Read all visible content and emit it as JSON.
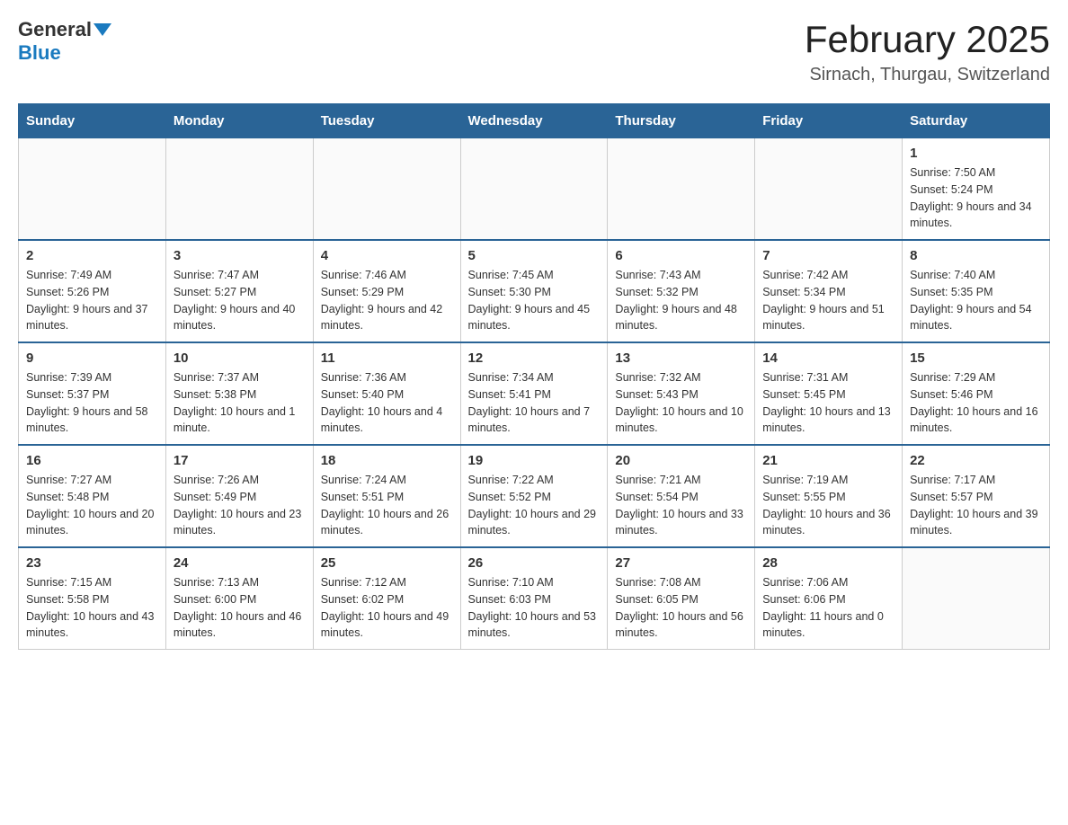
{
  "header": {
    "logo": {
      "general": "General",
      "blue": "Blue"
    },
    "title": "February 2025",
    "location": "Sirnach, Thurgau, Switzerland"
  },
  "weekdays": [
    "Sunday",
    "Monday",
    "Tuesday",
    "Wednesday",
    "Thursday",
    "Friday",
    "Saturday"
  ],
  "weeks": [
    [
      {
        "day": "",
        "info": ""
      },
      {
        "day": "",
        "info": ""
      },
      {
        "day": "",
        "info": ""
      },
      {
        "day": "",
        "info": ""
      },
      {
        "day": "",
        "info": ""
      },
      {
        "day": "",
        "info": ""
      },
      {
        "day": "1",
        "info": "Sunrise: 7:50 AM\nSunset: 5:24 PM\nDaylight: 9 hours and 34 minutes."
      }
    ],
    [
      {
        "day": "2",
        "info": "Sunrise: 7:49 AM\nSunset: 5:26 PM\nDaylight: 9 hours and 37 minutes."
      },
      {
        "day": "3",
        "info": "Sunrise: 7:47 AM\nSunset: 5:27 PM\nDaylight: 9 hours and 40 minutes."
      },
      {
        "day": "4",
        "info": "Sunrise: 7:46 AM\nSunset: 5:29 PM\nDaylight: 9 hours and 42 minutes."
      },
      {
        "day": "5",
        "info": "Sunrise: 7:45 AM\nSunset: 5:30 PM\nDaylight: 9 hours and 45 minutes."
      },
      {
        "day": "6",
        "info": "Sunrise: 7:43 AM\nSunset: 5:32 PM\nDaylight: 9 hours and 48 minutes."
      },
      {
        "day": "7",
        "info": "Sunrise: 7:42 AM\nSunset: 5:34 PM\nDaylight: 9 hours and 51 minutes."
      },
      {
        "day": "8",
        "info": "Sunrise: 7:40 AM\nSunset: 5:35 PM\nDaylight: 9 hours and 54 minutes."
      }
    ],
    [
      {
        "day": "9",
        "info": "Sunrise: 7:39 AM\nSunset: 5:37 PM\nDaylight: 9 hours and 58 minutes."
      },
      {
        "day": "10",
        "info": "Sunrise: 7:37 AM\nSunset: 5:38 PM\nDaylight: 10 hours and 1 minute."
      },
      {
        "day": "11",
        "info": "Sunrise: 7:36 AM\nSunset: 5:40 PM\nDaylight: 10 hours and 4 minutes."
      },
      {
        "day": "12",
        "info": "Sunrise: 7:34 AM\nSunset: 5:41 PM\nDaylight: 10 hours and 7 minutes."
      },
      {
        "day": "13",
        "info": "Sunrise: 7:32 AM\nSunset: 5:43 PM\nDaylight: 10 hours and 10 minutes."
      },
      {
        "day": "14",
        "info": "Sunrise: 7:31 AM\nSunset: 5:45 PM\nDaylight: 10 hours and 13 minutes."
      },
      {
        "day": "15",
        "info": "Sunrise: 7:29 AM\nSunset: 5:46 PM\nDaylight: 10 hours and 16 minutes."
      }
    ],
    [
      {
        "day": "16",
        "info": "Sunrise: 7:27 AM\nSunset: 5:48 PM\nDaylight: 10 hours and 20 minutes."
      },
      {
        "day": "17",
        "info": "Sunrise: 7:26 AM\nSunset: 5:49 PM\nDaylight: 10 hours and 23 minutes."
      },
      {
        "day": "18",
        "info": "Sunrise: 7:24 AM\nSunset: 5:51 PM\nDaylight: 10 hours and 26 minutes."
      },
      {
        "day": "19",
        "info": "Sunrise: 7:22 AM\nSunset: 5:52 PM\nDaylight: 10 hours and 29 minutes."
      },
      {
        "day": "20",
        "info": "Sunrise: 7:21 AM\nSunset: 5:54 PM\nDaylight: 10 hours and 33 minutes."
      },
      {
        "day": "21",
        "info": "Sunrise: 7:19 AM\nSunset: 5:55 PM\nDaylight: 10 hours and 36 minutes."
      },
      {
        "day": "22",
        "info": "Sunrise: 7:17 AM\nSunset: 5:57 PM\nDaylight: 10 hours and 39 minutes."
      }
    ],
    [
      {
        "day": "23",
        "info": "Sunrise: 7:15 AM\nSunset: 5:58 PM\nDaylight: 10 hours and 43 minutes."
      },
      {
        "day": "24",
        "info": "Sunrise: 7:13 AM\nSunset: 6:00 PM\nDaylight: 10 hours and 46 minutes."
      },
      {
        "day": "25",
        "info": "Sunrise: 7:12 AM\nSunset: 6:02 PM\nDaylight: 10 hours and 49 minutes."
      },
      {
        "day": "26",
        "info": "Sunrise: 7:10 AM\nSunset: 6:03 PM\nDaylight: 10 hours and 53 minutes."
      },
      {
        "day": "27",
        "info": "Sunrise: 7:08 AM\nSunset: 6:05 PM\nDaylight: 10 hours and 56 minutes."
      },
      {
        "day": "28",
        "info": "Sunrise: 7:06 AM\nSunset: 6:06 PM\nDaylight: 11 hours and 0 minutes."
      },
      {
        "day": "",
        "info": ""
      }
    ]
  ]
}
